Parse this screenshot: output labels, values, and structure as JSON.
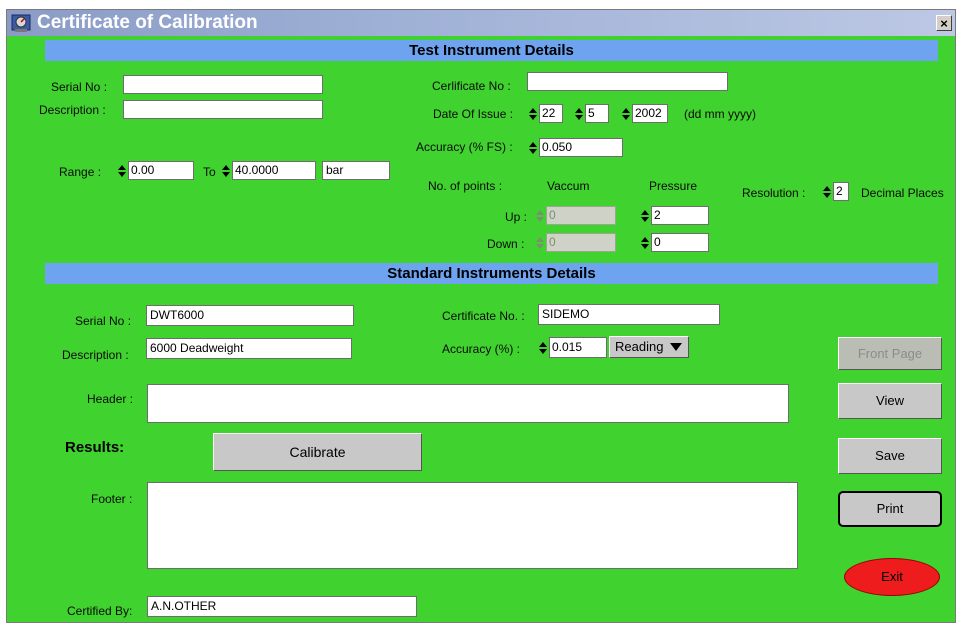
{
  "window": {
    "title": "Certificate of Calibration",
    "close_glyph": "×"
  },
  "test_section": {
    "heading": "Test Instrument Details",
    "serial_label": "Serial No :",
    "serial_value": "",
    "description_label": "Description :",
    "description_value": "",
    "certificate_label": "Cerlificate No :",
    "certificate_value": "",
    "date_label": "Date Of Issue :",
    "date_day": "22",
    "date_month": "5",
    "date_year": "2002",
    "date_format": "(dd mm yyyy)",
    "accuracy_label": "Accuracy (% FS) :",
    "accuracy_value": "0.050",
    "range_label": "Range :",
    "range_from": "0.00",
    "range_to_label": "To",
    "range_to": "40.0000",
    "range_unit": "bar",
    "points_label": "No. of points :",
    "vaccum_label": "Vaccum",
    "pressure_label": "Pressure",
    "up_label": "Up :",
    "down_label": "Down :",
    "vaccum_up": "0",
    "vaccum_down": "0",
    "pressure_up": "2",
    "pressure_down": "0",
    "resolution_label": "Resolution :",
    "resolution_value": "2",
    "resolution_unit": "Decimal Places"
  },
  "standard_section": {
    "heading": "Standard Instruments Details",
    "serial_label": "Serial No :",
    "serial_value": "DWT6000",
    "description_label": "Description :",
    "description_value": "6000 Deadweight",
    "certificate_label": "Certificate No. :",
    "certificate_value": "SIDEMO",
    "accuracy_label": "Accuracy (%) :",
    "accuracy_value": "0.015",
    "accuracy_mode": "Reading"
  },
  "report": {
    "header_label": "Header :",
    "header_value": "",
    "results_label": "Results:",
    "calibrate_button": "Calibrate",
    "footer_label": "Footer :",
    "footer_value": "",
    "certified_label": "Certified By:",
    "certified_value": "A.N.OTHER"
  },
  "actions": {
    "front_page": "Front Page",
    "view": "View",
    "save": "Save",
    "print": "Print",
    "exit": "Exit"
  },
  "colors": {
    "background": "#40d22e",
    "section_band": "#6ea3f0",
    "exit_button": "#ee1c1c"
  }
}
